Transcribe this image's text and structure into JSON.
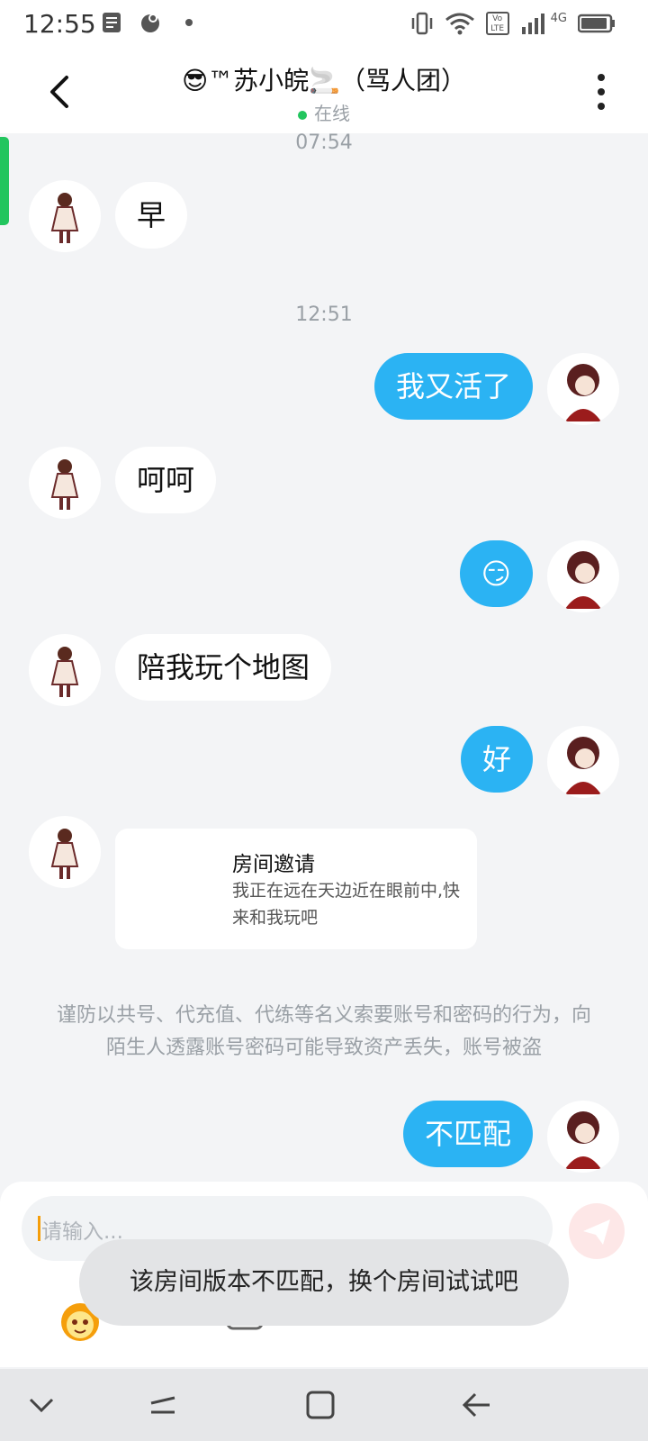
{
  "status_bar": {
    "time": "12:55",
    "network_label": "4G",
    "volte_label": "Vo LTE"
  },
  "header": {
    "title": "😎™苏小皖🚬（骂人团）",
    "status": "在线"
  },
  "timestamps": [
    "07:54",
    "12:51"
  ],
  "messages": [
    {
      "direction": "in",
      "text": "早"
    },
    {
      "direction": "out",
      "text": "我又活了"
    },
    {
      "direction": "in",
      "text": "呵呵"
    },
    {
      "direction": "out",
      "text": "😏"
    },
    {
      "direction": "in",
      "text": "陪我玩个地图"
    },
    {
      "direction": "out",
      "text": "好"
    },
    {
      "direction": "out",
      "text": "不匹配"
    }
  ],
  "invite": {
    "title": "房间邀请",
    "text": "我正在远在天边近在眼前中,快来和我玩吧"
  },
  "warning": "谨防以共号、代充值、代练等名义索要账号和密码的行为，向陌生人透露账号密码可能导致资产丢失，账号被盗",
  "input": {
    "placeholder": "请输入..."
  },
  "toast": "该房间版本不匹配，换个房间试试吧",
  "colors": {
    "outgoing_bubble": "#2bb3f3",
    "online": "#22c55e",
    "background": "#f3f4f6"
  },
  "icons": [
    "notes-icon",
    "app-icon",
    "dot-icon",
    "vibrate-icon",
    "wifi-icon",
    "volte-icon",
    "signal-icon",
    "battery-icon",
    "back-icon",
    "more-icon",
    "send-icon",
    "emoji-icon",
    "image-icon",
    "chevron-down-icon",
    "recents-icon",
    "home-icon",
    "nav-back-icon"
  ]
}
